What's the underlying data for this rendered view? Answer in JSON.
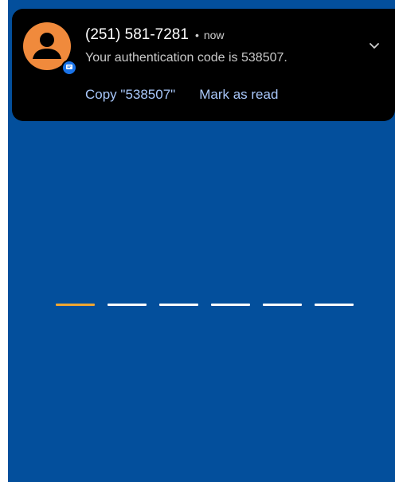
{
  "notification": {
    "sender": "(251) 581-7281",
    "separator": "•",
    "time": "now",
    "message": "Your authentication code is 538507.",
    "actions": [
      {
        "label": "Copy \"538507\""
      },
      {
        "label": "Mark as read"
      }
    ],
    "avatar_icon": "person-icon",
    "app_badge_icon": "messages-icon",
    "expand_icon": "chevron-down-icon"
  },
  "code_entry": {
    "slot_count": 6,
    "active_slot": 1
  },
  "colors": {
    "background": "#034f9c",
    "notification_bg": "#000000",
    "avatar": "#f08a3c",
    "action_text": "#a8c7fa",
    "active_slot": "#f0a630",
    "inactive_slot": "#ffffff"
  }
}
